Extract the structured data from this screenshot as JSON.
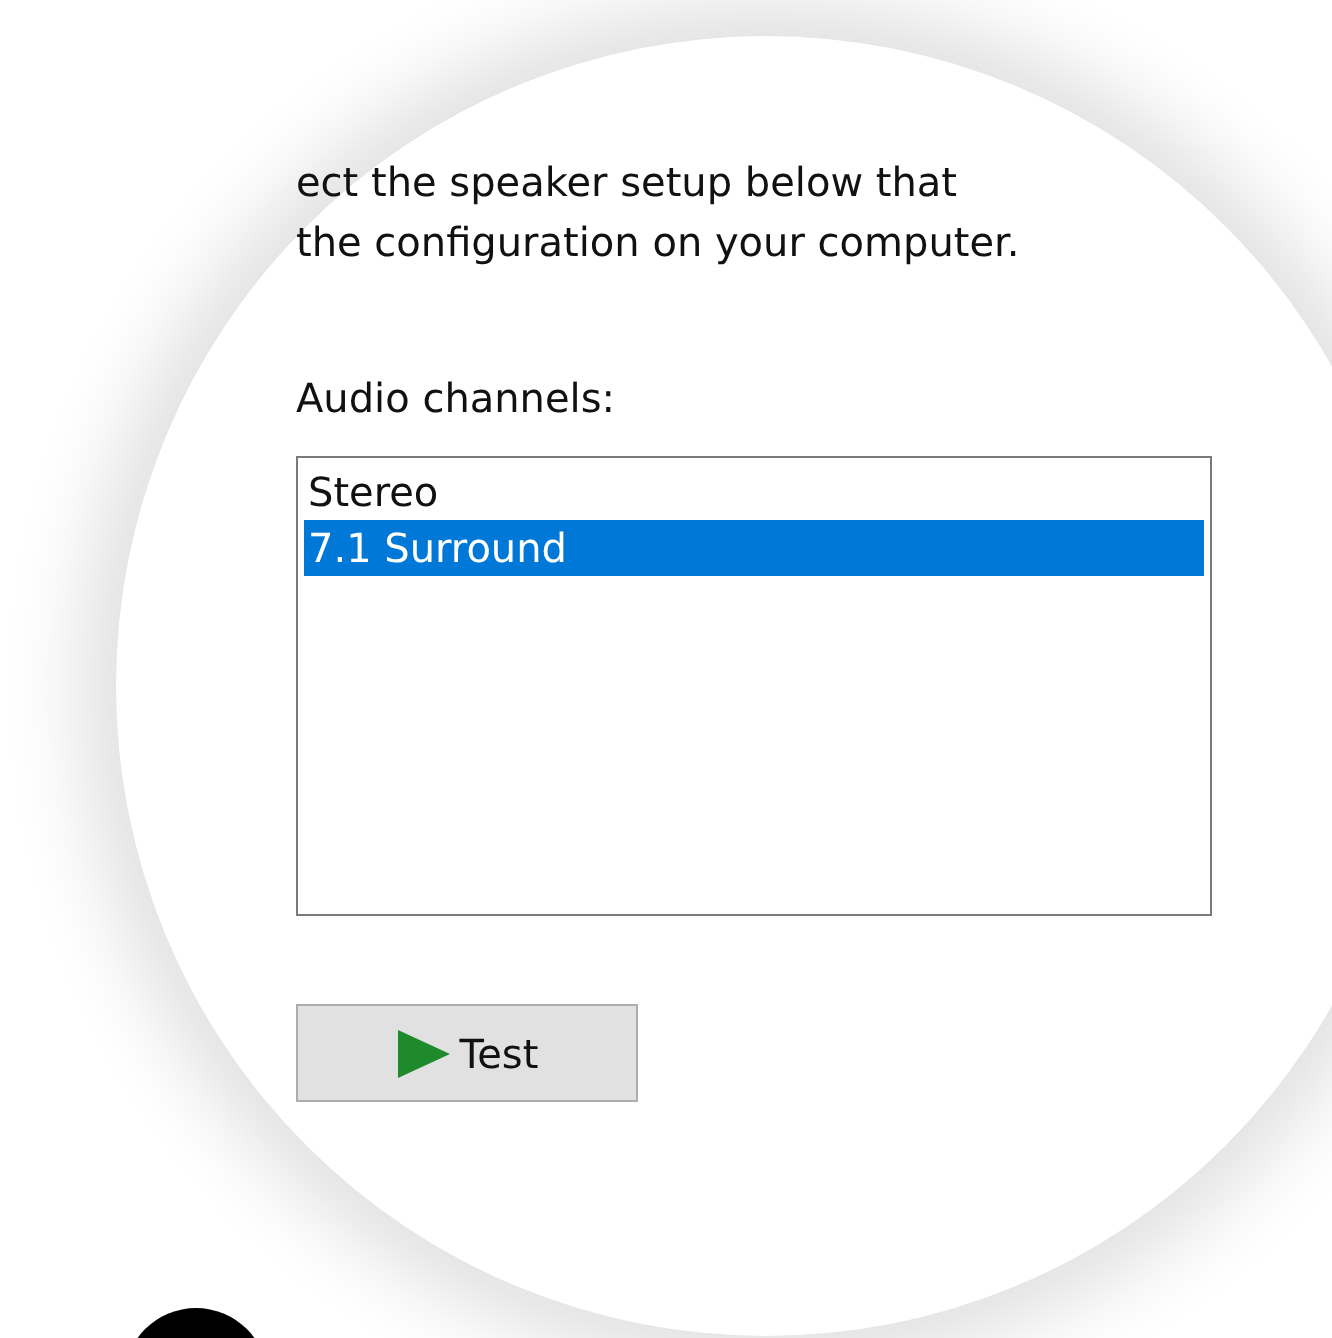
{
  "instructions": [
    "ect the speaker setup below that",
    "the configuration on your computer."
  ],
  "channels_label": "Audio channels:",
  "channels": [
    {
      "label": "Stereo",
      "selected": false
    },
    {
      "label": "7.1 Surround",
      "selected": true
    }
  ],
  "test_button": {
    "label": "Test"
  }
}
